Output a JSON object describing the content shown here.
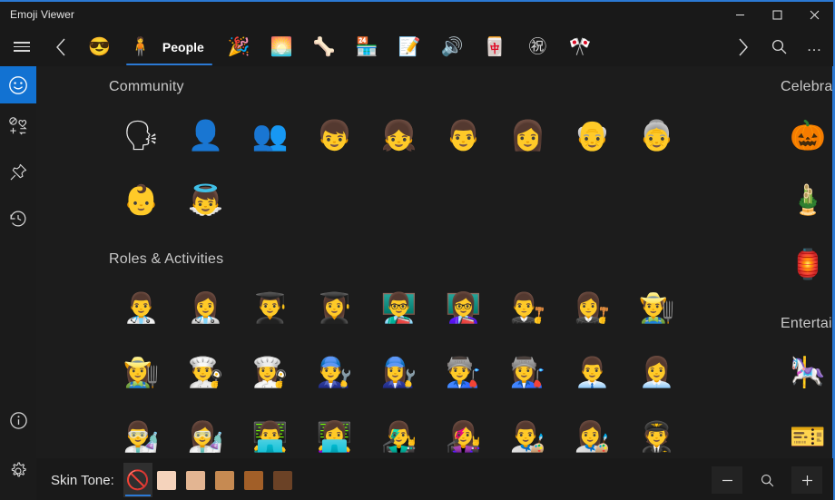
{
  "window": {
    "title": "Emoji Viewer",
    "accent_color": "#2b79d4",
    "background_color": "#191919",
    "minimize_label": "Minimize",
    "maximize_label": "Maximize",
    "close_label": "Close"
  },
  "commandbar": {
    "menu_label": "Menu",
    "back_label": "Back",
    "forward_label": "Forward",
    "search_label": "Search",
    "more_label": "See more",
    "tabs": [
      {
        "id": "smileys",
        "icon": "smiley-sunglasses-icon",
        "glyph": "😎",
        "label": "",
        "selected": false
      },
      {
        "id": "people",
        "icon": "person-icon",
        "glyph": "🧍",
        "label": "People",
        "selected": true
      },
      {
        "id": "celebration",
        "icon": "party-popper-icon",
        "glyph": "🎉",
        "label": "",
        "selected": false
      },
      {
        "id": "nature",
        "icon": "sunrise-icon",
        "glyph": "🌅",
        "label": "",
        "selected": false
      },
      {
        "id": "food",
        "icon": "bone-icon",
        "glyph": "🦴",
        "label": "",
        "selected": false
      },
      {
        "id": "objects",
        "icon": "shopping-store-icon",
        "glyph": "🏪",
        "label": "",
        "selected": false
      },
      {
        "id": "symbols",
        "icon": "memo-pencil-icon",
        "glyph": "📝",
        "label": "",
        "selected": false
      },
      {
        "id": "sound",
        "icon": "speaker-icon",
        "glyph": "🔊",
        "label": "",
        "selected": false
      },
      {
        "id": "kaomoji",
        "icon": "mahjong-tile-icon",
        "glyph": "🀄",
        "label": "",
        "selected": false
      },
      {
        "id": "ideographs",
        "icon": "japanese-congratulations-icon",
        "glyph": "㊗",
        "label": "",
        "selected": false
      },
      {
        "id": "flags",
        "icon": "crossed-flags-icon",
        "glyph": "🎌",
        "label": "",
        "selected": false
      }
    ]
  },
  "rail": {
    "items": [
      {
        "id": "emoji",
        "icon": "smiley-face-icon",
        "label": "Emoji",
        "active": true
      },
      {
        "id": "symbols",
        "icon": "symbols-icon",
        "label": "Symbols",
        "active": false
      },
      {
        "id": "pinned",
        "icon": "pin-icon",
        "label": "Pinned",
        "active": false
      },
      {
        "id": "recent",
        "icon": "history-clock-icon",
        "label": "Recently used",
        "active": false
      }
    ],
    "bottom_items": [
      {
        "id": "info",
        "icon": "info-circle-icon",
        "label": "About",
        "active": false
      },
      {
        "id": "settings",
        "icon": "gear-icon",
        "label": "Settings",
        "active": false
      }
    ]
  },
  "main": {
    "sections": [
      {
        "title": "Community",
        "rows": [
          [
            {
              "name": "speaking-head",
              "glyph": "🗣"
            },
            {
              "name": "bust-in-silhouette",
              "glyph": "👤"
            },
            {
              "name": "busts-in-silhouette",
              "glyph": "👥"
            },
            {
              "name": "boy",
              "glyph": "👦"
            },
            {
              "name": "girl",
              "glyph": "👧"
            },
            {
              "name": "man",
              "glyph": "👨"
            },
            {
              "name": "woman",
              "glyph": "👩"
            },
            {
              "name": "older-man",
              "glyph": "👴"
            },
            {
              "name": "older-woman",
              "glyph": "👵"
            }
          ],
          [
            {
              "name": "baby",
              "glyph": "👶"
            },
            {
              "name": "baby-angel",
              "glyph": "👼"
            }
          ]
        ]
      },
      {
        "title": "Roles & Activities",
        "rows": [
          [
            {
              "name": "man-health-worker",
              "glyph": "👨‍⚕️"
            },
            {
              "name": "woman-health-worker",
              "glyph": "👩‍⚕️"
            },
            {
              "name": "man-student",
              "glyph": "👨‍🎓"
            },
            {
              "name": "woman-student",
              "glyph": "👩‍🎓"
            },
            {
              "name": "man-teacher",
              "glyph": "👨‍🏫"
            },
            {
              "name": "woman-teacher",
              "glyph": "👩‍🏫"
            },
            {
              "name": "man-judge",
              "glyph": "👨‍⚖️"
            },
            {
              "name": "woman-judge",
              "glyph": "👩‍⚖️"
            },
            {
              "name": "man-farmer",
              "glyph": "👨‍🌾"
            }
          ],
          [
            {
              "name": "woman-farmer",
              "glyph": "👩‍🌾"
            },
            {
              "name": "man-cook",
              "glyph": "👨‍🍳"
            },
            {
              "name": "woman-cook",
              "glyph": "👩‍🍳"
            },
            {
              "name": "man-mechanic",
              "glyph": "👨‍🔧"
            },
            {
              "name": "woman-mechanic",
              "glyph": "👩‍🔧"
            },
            {
              "name": "man-factory-worker",
              "glyph": "👨‍🏭"
            },
            {
              "name": "woman-factory-worker",
              "glyph": "👩‍🏭"
            },
            {
              "name": "man-office-worker",
              "glyph": "👨‍💼"
            },
            {
              "name": "woman-office-worker",
              "glyph": "👩‍💼"
            }
          ],
          [
            {
              "name": "man-scientist",
              "glyph": "👨‍🔬"
            },
            {
              "name": "woman-scientist",
              "glyph": "👩‍🔬"
            },
            {
              "name": "man-technologist",
              "glyph": "👨‍💻"
            },
            {
              "name": "woman-technologist",
              "glyph": "👩‍💻"
            },
            {
              "name": "man-singer",
              "glyph": "👨‍🎤"
            },
            {
              "name": "woman-singer",
              "glyph": "👩‍🎤"
            },
            {
              "name": "man-artist",
              "glyph": "👨‍🎨"
            },
            {
              "name": "woman-artist",
              "glyph": "👩‍🎨"
            },
            {
              "name": "pilot",
              "glyph": "🧑‍✈️"
            }
          ]
        ]
      }
    ],
    "next_column_sections": [
      {
        "title": "Celebration",
        "items": [
          {
            "name": "jack-o-lantern",
            "glyph": "🎃"
          },
          {
            "name": "pine-decoration",
            "glyph": "🎍"
          },
          {
            "name": "red-paper-lantern",
            "glyph": "🏮"
          }
        ]
      },
      {
        "title": "Entertainment",
        "items": [
          {
            "name": "carousel-horse",
            "glyph": "🎠"
          },
          {
            "name": "ticket",
            "glyph": "🎫"
          }
        ]
      }
    ]
  },
  "bottombar": {
    "skin_tone_label": "Skin Tone:",
    "swatches": [
      {
        "id": "none",
        "label": "Default (no skin tone)",
        "color": "",
        "glyph": "🚫",
        "selected": true
      },
      {
        "id": "light",
        "label": "Light skin tone",
        "color": "#f5d3bc",
        "glyph": "",
        "selected": false
      },
      {
        "id": "medium-light",
        "label": "Medium-light skin tone",
        "color": "#e3b592",
        "glyph": "",
        "selected": false
      },
      {
        "id": "medium",
        "label": "Medium skin tone",
        "color": "#c68a52",
        "glyph": "",
        "selected": false
      },
      {
        "id": "medium-dark",
        "label": "Medium-dark skin tone",
        "color": "#a25f28",
        "glyph": "",
        "selected": false
      },
      {
        "id": "dark",
        "label": "Dark skin tone",
        "color": "#6b4226",
        "glyph": "",
        "selected": false
      }
    ],
    "zoom_out_label": "Zoom out",
    "zoom_reset_label": "Reset zoom",
    "zoom_in_label": "Zoom in"
  }
}
